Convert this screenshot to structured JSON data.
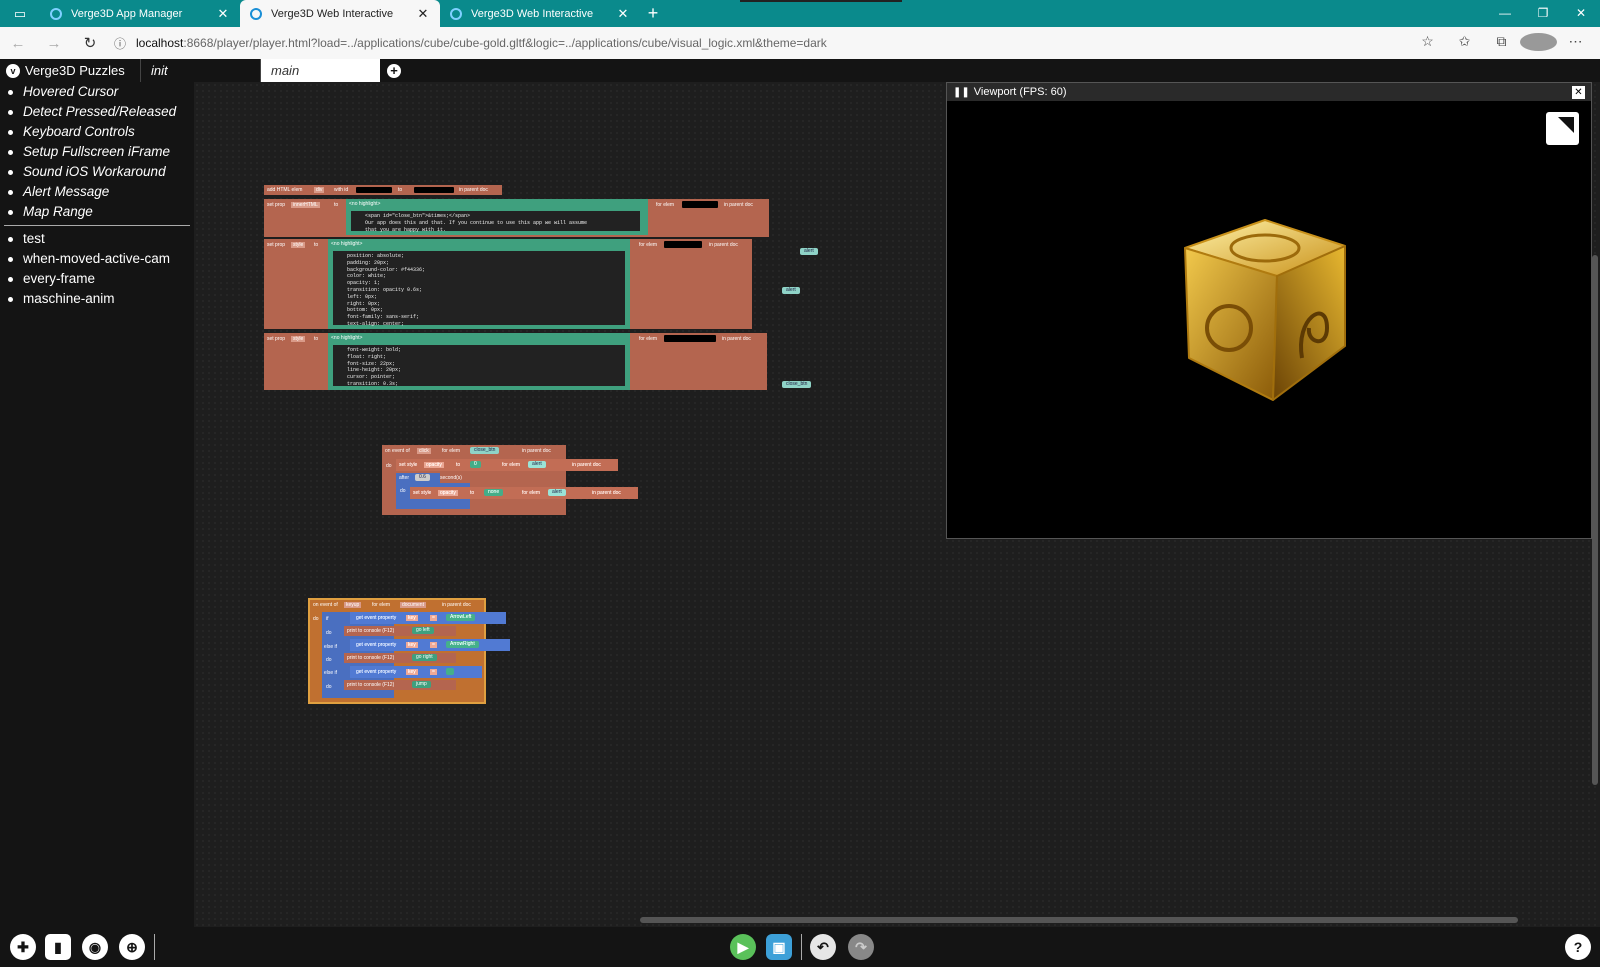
{
  "browser": {
    "tabs": [
      {
        "label": "Verge3D App Manager",
        "active": false
      },
      {
        "label": "Verge3D Web Interactive",
        "active": true
      },
      {
        "label": "Verge3D Web Interactive",
        "active": false
      }
    ],
    "new_tab_icon": "plus-icon",
    "url_host": "localhost",
    "url_rest": ":8668/player/player.html?load=../applications/cube/cube-gold.gltf&logic=../applications/cube/visual_logic.xml&theme=dark"
  },
  "app": {
    "title": "Verge3D Puzzles",
    "logo_glyph": "v",
    "workspace_tabs": [
      "init",
      "main"
    ],
    "selected_workspace": "main"
  },
  "sidebar": {
    "library_items": [
      "Hovered Cursor",
      "Detect Pressed/Released",
      "Keyboard Controls",
      "Setup Fullscreen iFrame",
      "Sound iOS Workaround",
      "Alert Message",
      "Map Range"
    ],
    "procedures": [
      "test",
      "when-moved-active-cam",
      "every-frame",
      "maschine-anim"
    ]
  },
  "workspace": {
    "html_block": {
      "add_label": "add HTML elem",
      "add_tag": "div",
      "with_id": "with id",
      "to_label": "to",
      "in_parent": "in parent doc",
      "setprop1": {
        "label": "set prop",
        "prop": "innerHTML",
        "to": "to",
        "tag": "<no highlight>",
        "for_elem": "for elem",
        "code": [
          "<span id=\"close_btn\">&times;</span>",
          "Our app does this and that. If you continue to use this app we will assume",
          "that you are happy with it."
        ]
      },
      "setprop2": {
        "label": "set prop",
        "prop": "style",
        "to": "to",
        "tag": "<no highlight>",
        "for_elem": "for elem",
        "code": [
          "position: absolute;",
          "padding: 20px;",
          "background-color: #f44336;",
          "color: white;",
          "opacity: 1;",
          "transition: opacity 0.6s;",
          "left: 0px;",
          "right: 0px;",
          "bottom: 0px;",
          "font-family: sans-serif;",
          "text-align: center;"
        ]
      },
      "setprop3": {
        "label": "set prop",
        "prop": "style",
        "to": "to",
        "tag": "<no highlight>",
        "for_elem": "for elem",
        "code": [
          "font-weight: bold;",
          "float: right;",
          "font-size: 22px;",
          "line-height: 20px;",
          "cursor: pointer;",
          "transition: 0.3s;"
        ]
      },
      "chips": [
        "alert",
        "alert",
        "close_btn"
      ]
    },
    "event_block": {
      "on_event": "on event of",
      "event": "click",
      "for_elem": "for elem",
      "elem": "close_btn",
      "in_parent": "in parent doc",
      "do": "do",
      "set_style": "set style",
      "style_prop": "opacity",
      "to": "to",
      "val1": "0",
      "target1": "alert",
      "after": "after",
      "seconds_val": "0.6",
      "seconds": "second(s)",
      "val2": "none",
      "target2": "alert"
    },
    "key_block": {
      "on_event": "on event of",
      "event": "keyup",
      "for_elem": "for elem",
      "elem": "document",
      "in_parent": "in parent doc",
      "do": "do",
      "if": "if",
      "else_if": "else if",
      "get_prop": "get event property",
      "prop": "key",
      "eq": "=",
      "keys": [
        "ArrowLeft",
        "ArrowRight",
        " "
      ],
      "print": "print to console (F12)",
      "messages": [
        "go left",
        "go right",
        "jump"
      ]
    }
  },
  "viewport": {
    "title": "Viewport (FPS: 60)",
    "close_glyph": "✕"
  },
  "toolbar": {
    "icons": [
      "puzzle-library-icon",
      "sidebar-toggle-icon",
      "screenshot-icon",
      "center-workspace-icon",
      "run-icon",
      "save-icon",
      "undo-icon",
      "redo-icon",
      "help-icon"
    ],
    "help_glyph": "?"
  },
  "colors": {
    "browser_accent": "#0a8a8c",
    "puzzle_brown": "#b4654f",
    "puzzle_teal": "#3fa07e",
    "puzzle_blue": "#4a6fc0",
    "cube_gold": "#d4a017"
  }
}
